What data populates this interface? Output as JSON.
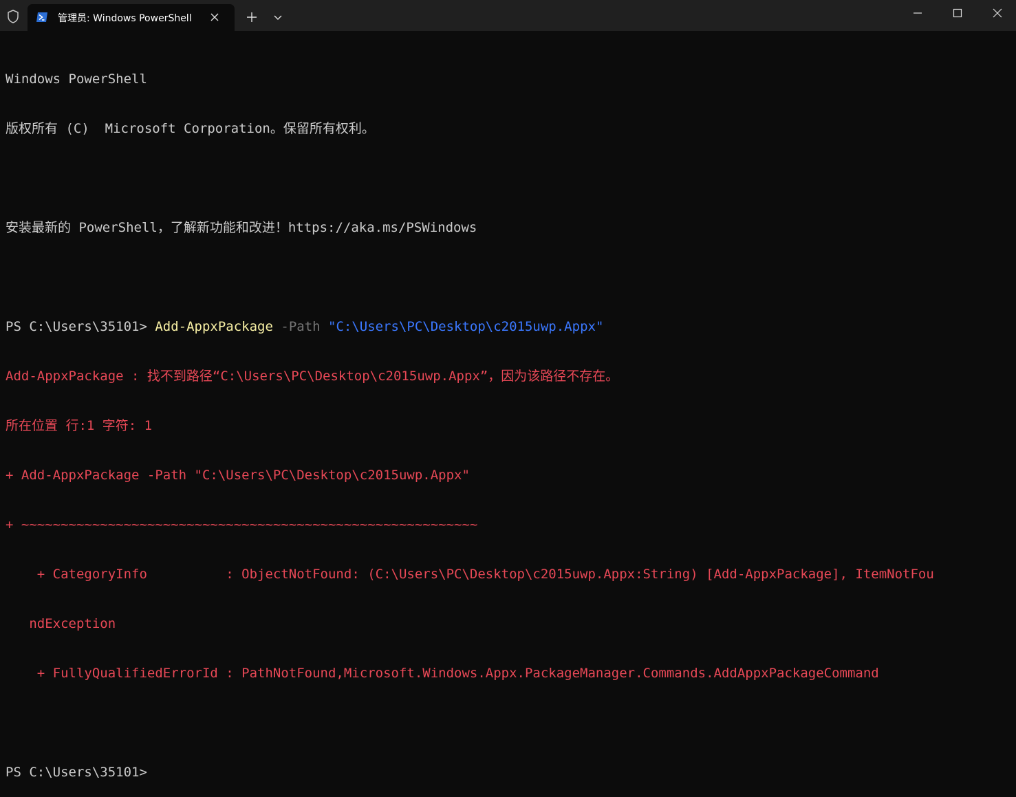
{
  "window": {
    "tab_title": "管理员: Windows PowerShell"
  },
  "terminal": {
    "banner_1": "Windows PowerShell",
    "banner_2": "版权所有 (C)  Microsoft Corporation。保留所有权利。",
    "banner_3": "安装最新的 PowerShell，了解新功能和改进！https://aka.ms/PSWindows",
    "prompt_1": "PS C:\\Users\\35101> ",
    "cmd_name": "Add-AppxPackage",
    "cmd_param": " -Path ",
    "cmd_arg": "\"C:\\Users\\PC\\Desktop\\c2015uwp.Appx\"",
    "err_1": "Add-AppxPackage : 找不到路径“C:\\Users\\PC\\Desktop\\c2015uwp.Appx”，因为该路径不存在。",
    "err_2": "所在位置 行:1 字符: 1",
    "err_3": "+ Add-AppxPackage -Path \"C:\\Users\\PC\\Desktop\\c2015uwp.Appx\"",
    "err_4": "+ ~~~~~~~~~~~~~~~~~~~~~~~~~~~~~~~~~~~~~~~~~~~~~~~~~~~~~~~~~~",
    "err_5": "    + CategoryInfo          : ObjectNotFound: (C:\\Users\\PC\\Desktop\\c2015uwp.Appx:String) [Add-AppxPackage], ItemNotFou",
    "err_6": "   ndException",
    "err_7": "    + FullyQualifiedErrorId : PathNotFound,Microsoft.Windows.Appx.PackageManager.Commands.AddAppxPackageCommand",
    "prompt_2": "PS C:\\Users\\35101>"
  },
  "colors": {
    "background": "#0c0c0c",
    "titlebar": "#202020",
    "error": "#e74856",
    "command": "#f9f1a5",
    "parameter": "#767676",
    "string": "#3b78ff"
  }
}
